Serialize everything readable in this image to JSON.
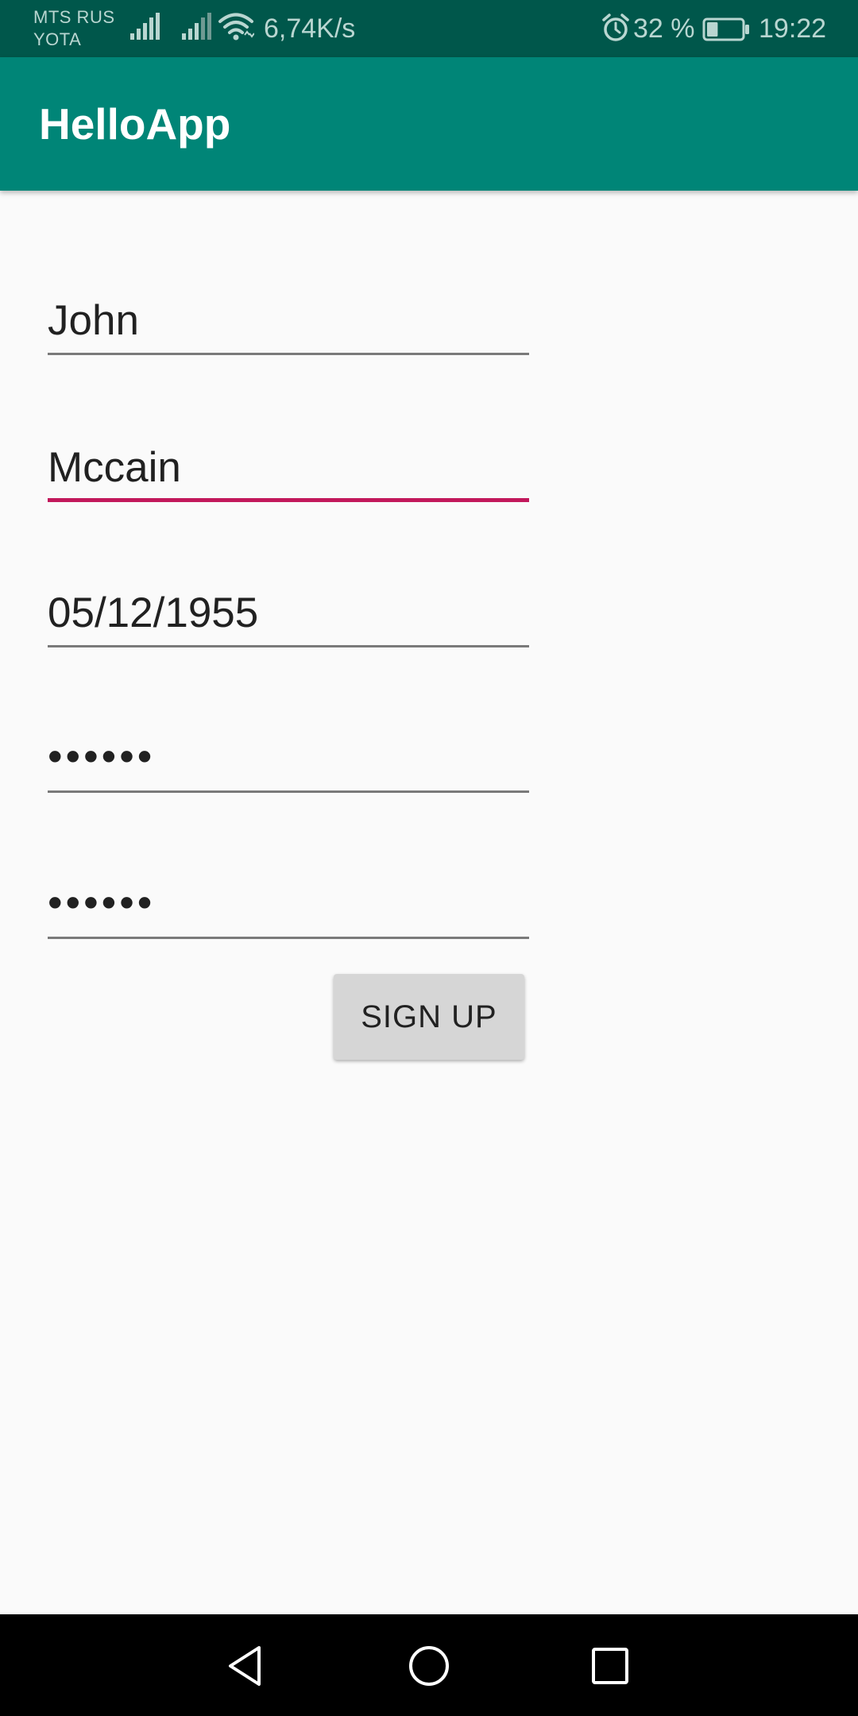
{
  "status_bar": {
    "carrier_1": "MTS RUS",
    "carrier_2": "YOTA",
    "network_speed": "6,74K/s",
    "battery_percent": "32 %",
    "battery_level": 0.32,
    "time": "19:22",
    "icons": [
      "signal-icon",
      "signal-icon",
      "wifi-icon",
      "alarm-icon",
      "battery-icon"
    ]
  },
  "app_bar": {
    "title": "HelloApp"
  },
  "form": {
    "fields": [
      {
        "value": "John",
        "focused": false
      },
      {
        "value": "Mccain",
        "focused": true
      },
      {
        "value": "05/12/1955",
        "focused": false
      },
      {
        "value": "••••••",
        "focused": false
      },
      {
        "value": "••••••",
        "focused": false
      }
    ],
    "signup_label": "SIGN UP"
  },
  "nav_bar": {
    "icons": [
      "back-icon",
      "home-icon",
      "recents-icon"
    ]
  },
  "colors": {
    "status_bar": "#00574b",
    "app_bar": "#008577",
    "accent": "#c2185b",
    "background": "#fafafa"
  }
}
